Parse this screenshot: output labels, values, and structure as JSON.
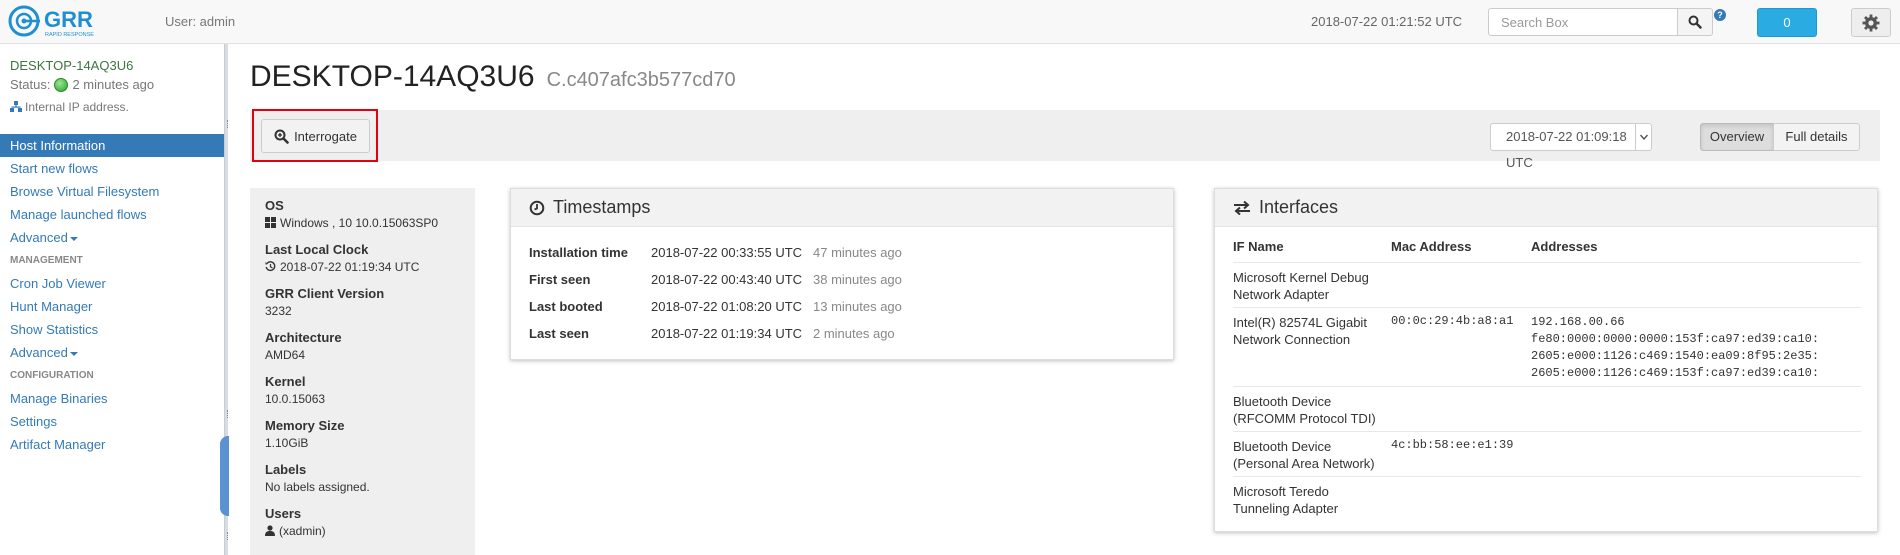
{
  "topbar": {
    "logo_text": "GRR",
    "logo_sub": "RAPID RESPONSE",
    "user": "User: admin",
    "clock": "2018-07-22 01:21:52 UTC",
    "search_placeholder": "Search Box",
    "help": "?",
    "notification_count": "0"
  },
  "sidebar": {
    "hostname": "DESKTOP-14AQ3U6",
    "status_label": "Status:",
    "status_time": "2 minutes ago",
    "ip_text": "Internal IP address.",
    "nav": [
      {
        "label": "Host Information"
      },
      {
        "label": "Start new flows"
      },
      {
        "label": "Browse Virtual Filesystem"
      },
      {
        "label": "Manage launched flows"
      },
      {
        "label": "Advanced"
      },
      {
        "label": "MANAGEMENT"
      },
      {
        "label": "Cron Job Viewer"
      },
      {
        "label": "Hunt Manager"
      },
      {
        "label": "Show Statistics"
      },
      {
        "label": "Advanced"
      },
      {
        "label": "CONFIGURATION"
      },
      {
        "label": "Manage Binaries"
      },
      {
        "label": "Settings"
      },
      {
        "label": "Artifact Manager"
      }
    ]
  },
  "header": {
    "hostname": "DESKTOP-14AQ3U6",
    "client_id": "C.c407afc3b577cd70"
  },
  "toolbar": {
    "interrogate": "Interrogate",
    "date": "2018-07-22 01:09:18 UTC",
    "overview": "Overview",
    "full_details": "Full details"
  },
  "summary": {
    "os_label": "OS",
    "os_value": "Windows , 10 10.0.15063SP0",
    "clock_label": "Last Local Clock",
    "clock_value": "2018-07-22 01:19:34 UTC",
    "version_label": "GRR Client Version",
    "version_value": "3232",
    "arch_label": "Architecture",
    "arch_value": "AMD64",
    "kernel_label": "Kernel",
    "kernel_value": "10.0.15063",
    "memory_label": "Memory Size",
    "memory_value": "1.10GiB",
    "labels_label": "Labels",
    "labels_value": "No labels assigned.",
    "users_label": "Users",
    "users_value": "(xadmin)"
  },
  "timestamps": {
    "title": "Timestamps",
    "rows": [
      {
        "label": "Installation time",
        "value": "2018-07-22 00:33:55 UTC",
        "ago": "47 minutes ago"
      },
      {
        "label": "First seen",
        "value": "2018-07-22 00:43:40 UTC",
        "ago": "38 minutes ago"
      },
      {
        "label": "Last booted",
        "value": "2018-07-22 01:08:20 UTC",
        "ago": "13 minutes ago"
      },
      {
        "label": "Last seen",
        "value": "2018-07-22 01:19:34 UTC",
        "ago": "2 minutes ago"
      }
    ]
  },
  "interfaces": {
    "title": "Interfaces",
    "headers": {
      "name": "IF Name",
      "mac": "Mac Address",
      "addresses": "Addresses"
    },
    "rows": [
      {
        "name1": "Microsoft Kernel Debug",
        "name2": "Network Adapter",
        "mac": "",
        "addresses": []
      },
      {
        "name1": "Intel(R) 82574L Gigabit",
        "name2": "Network Connection",
        "mac": "00:0c:29:4b:a8:a1",
        "addresses": [
          "192.168.00.66",
          "fe80:0000:0000:0000:153f:ca97:ed39:ca10:",
          "2605:e000:1126:c469:1540:ea09:8f95:2e35:",
          "2605:e000:1126:c469:153f:ca97:ed39:ca10:"
        ]
      },
      {
        "name1": "Bluetooth Device",
        "name2": "(RFCOMM Protocol TDI)",
        "mac": "",
        "addresses": []
      },
      {
        "name1": "Bluetooth Device",
        "name2": "(Personal Area Network)",
        "mac": "4c:bb:58:ee:e1:39",
        "addresses": []
      },
      {
        "name1": "Microsoft Teredo",
        "name2": "Tunneling Adapter",
        "mac": "",
        "addresses": []
      }
    ]
  }
}
